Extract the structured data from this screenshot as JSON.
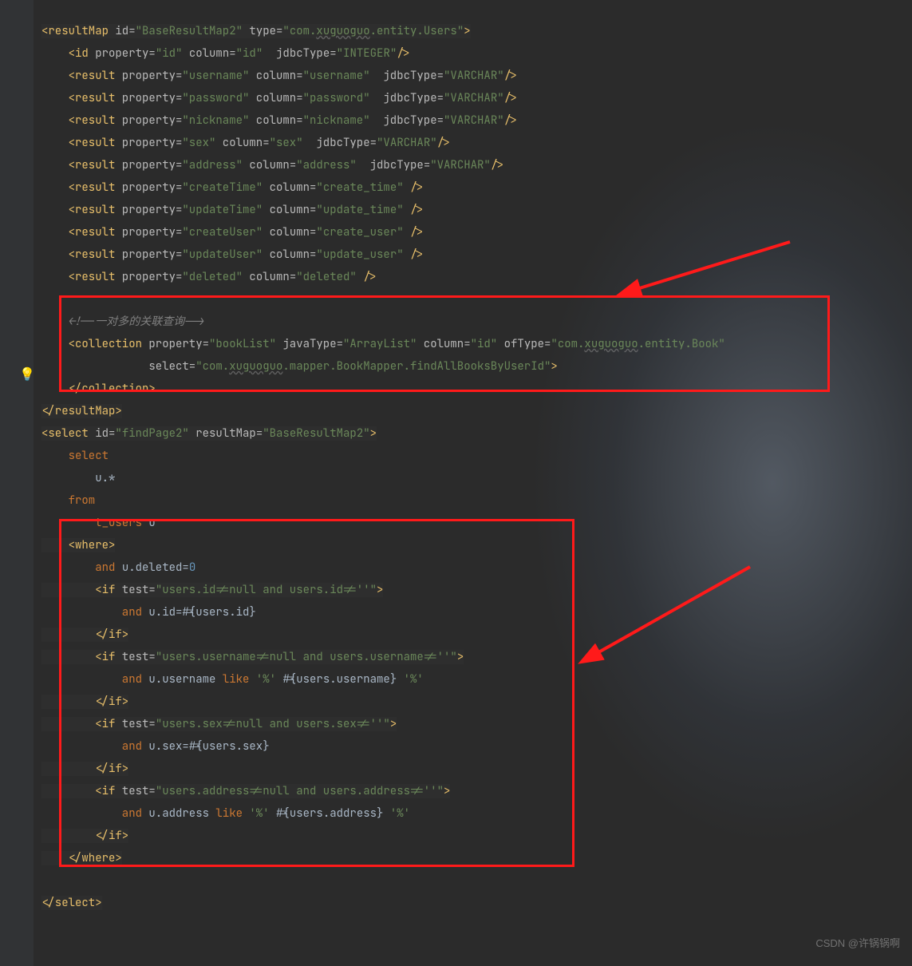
{
  "watermark": "CSDN @许锅锅啊",
  "code": {
    "lines": [
      {
        "i": 0,
        "hl": 1,
        "seg": [
          {
            "c": "t-tag",
            "t": "<resultMap"
          },
          {
            "c": "t-attr",
            "t": " id="
          },
          {
            "c": "t-str",
            "t": "\"BaseResultMap2\""
          },
          {
            "c": "t-attr",
            "t": " type="
          },
          {
            "c": "t-str",
            "t": "\"com."
          },
          {
            "c": "t-str t-wavy",
            "t": "xuguoguo"
          },
          {
            "c": "t-str",
            "t": ".entity.Users\""
          },
          {
            "c": "t-tag",
            "t": ">"
          }
        ]
      },
      {
        "i": 1,
        "seg": [
          {
            "c": "t-tag",
            "t": "<id"
          },
          {
            "c": "t-attr",
            "t": " property="
          },
          {
            "c": "t-str",
            "t": "\"id\""
          },
          {
            "c": "t-attr",
            "t": " column="
          },
          {
            "c": "t-str",
            "t": "\"id\""
          },
          {
            "c": "t-attr",
            "t": "  jdbcType="
          },
          {
            "c": "t-str",
            "t": "\"INTEGER\""
          },
          {
            "c": "t-tag",
            "t": "/>"
          }
        ]
      },
      {
        "i": 1,
        "seg": [
          {
            "c": "t-tag",
            "t": "<result"
          },
          {
            "c": "t-attr",
            "t": " property="
          },
          {
            "c": "t-str",
            "t": "\"username\""
          },
          {
            "c": "t-attr",
            "t": " column="
          },
          {
            "c": "t-str",
            "t": "\"username\""
          },
          {
            "c": "t-attr",
            "t": "  jdbcType="
          },
          {
            "c": "t-str",
            "t": "\"VARCHAR\""
          },
          {
            "c": "t-tag",
            "t": "/>"
          }
        ]
      },
      {
        "i": 1,
        "seg": [
          {
            "c": "t-tag",
            "t": "<result"
          },
          {
            "c": "t-attr",
            "t": " property="
          },
          {
            "c": "t-str",
            "t": "\"password\""
          },
          {
            "c": "t-attr",
            "t": " column="
          },
          {
            "c": "t-str",
            "t": "\"password\""
          },
          {
            "c": "t-attr",
            "t": "  jdbcType="
          },
          {
            "c": "t-str",
            "t": "\"VARCHAR\""
          },
          {
            "c": "t-tag",
            "t": "/>"
          }
        ]
      },
      {
        "i": 1,
        "seg": [
          {
            "c": "t-tag",
            "t": "<result"
          },
          {
            "c": "t-attr",
            "t": " property="
          },
          {
            "c": "t-str",
            "t": "\"nickname\""
          },
          {
            "c": "t-attr",
            "t": " column="
          },
          {
            "c": "t-str",
            "t": "\"nickname\""
          },
          {
            "c": "t-attr",
            "t": "  jdbcType="
          },
          {
            "c": "t-str",
            "t": "\"VARCHAR\""
          },
          {
            "c": "t-tag",
            "t": "/>"
          }
        ]
      },
      {
        "i": 1,
        "seg": [
          {
            "c": "t-tag",
            "t": "<result"
          },
          {
            "c": "t-attr",
            "t": " property="
          },
          {
            "c": "t-str",
            "t": "\"sex\""
          },
          {
            "c": "t-attr",
            "t": " column="
          },
          {
            "c": "t-str",
            "t": "\"sex\""
          },
          {
            "c": "t-attr",
            "t": "  jdbcType="
          },
          {
            "c": "t-str",
            "t": "\"VARCHAR\""
          },
          {
            "c": "t-tag",
            "t": "/>"
          }
        ]
      },
      {
        "i": 1,
        "seg": [
          {
            "c": "t-tag",
            "t": "<result"
          },
          {
            "c": "t-attr",
            "t": " property="
          },
          {
            "c": "t-str",
            "t": "\"address\""
          },
          {
            "c": "t-attr",
            "t": " column="
          },
          {
            "c": "t-str",
            "t": "\"address\""
          },
          {
            "c": "t-attr",
            "t": "  jdbcType="
          },
          {
            "c": "t-str",
            "t": "\"VARCHAR\""
          },
          {
            "c": "t-tag",
            "t": "/>"
          }
        ]
      },
      {
        "i": 1,
        "seg": [
          {
            "c": "t-tag",
            "t": "<result"
          },
          {
            "c": "t-attr",
            "t": " property="
          },
          {
            "c": "t-str",
            "t": "\"createTime\""
          },
          {
            "c": "t-attr",
            "t": " column="
          },
          {
            "c": "t-str",
            "t": "\"create_time\""
          },
          {
            "c": "t-tag",
            "t": " />"
          }
        ]
      },
      {
        "i": 1,
        "seg": [
          {
            "c": "t-tag",
            "t": "<result"
          },
          {
            "c": "t-attr",
            "t": " property="
          },
          {
            "c": "t-str",
            "t": "\"updateTime\""
          },
          {
            "c": "t-attr",
            "t": " column="
          },
          {
            "c": "t-str",
            "t": "\"update_time\""
          },
          {
            "c": "t-tag",
            "t": " />"
          }
        ]
      },
      {
        "i": 1,
        "seg": [
          {
            "c": "t-tag",
            "t": "<result"
          },
          {
            "c": "t-attr",
            "t": " property="
          },
          {
            "c": "t-str",
            "t": "\"createUser\""
          },
          {
            "c": "t-attr",
            "t": " column="
          },
          {
            "c": "t-str",
            "t": "\"create_user\""
          },
          {
            "c": "t-tag",
            "t": " />"
          }
        ]
      },
      {
        "i": 1,
        "seg": [
          {
            "c": "t-tag",
            "t": "<result"
          },
          {
            "c": "t-attr",
            "t": " property="
          },
          {
            "c": "t-str",
            "t": "\"updateUser\""
          },
          {
            "c": "t-attr",
            "t": " column="
          },
          {
            "c": "t-str",
            "t": "\"update_user\""
          },
          {
            "c": "t-tag",
            "t": " />"
          }
        ]
      },
      {
        "i": 1,
        "seg": [
          {
            "c": "t-tag",
            "t": "<result"
          },
          {
            "c": "t-attr",
            "t": " property="
          },
          {
            "c": "t-str",
            "t": "\"deleted\""
          },
          {
            "c": "t-attr",
            "t": " column="
          },
          {
            "c": "t-str",
            "t": "\"deleted\""
          },
          {
            "c": "t-tag",
            "t": " />"
          }
        ]
      },
      {
        "i": 0,
        "seg": []
      },
      {
        "i": 1,
        "seg": [
          {
            "c": "t-comment",
            "t": "<!--一对多的关联查询-->"
          }
        ]
      },
      {
        "i": 1,
        "seg": [
          {
            "c": "t-tag",
            "t": "<collection"
          },
          {
            "c": "t-attr",
            "t": " property="
          },
          {
            "c": "t-str",
            "t": "\"bookList\""
          },
          {
            "c": "t-attr",
            "t": " javaType="
          },
          {
            "c": "t-str",
            "t": "\"ArrayList\""
          },
          {
            "c": "t-attr",
            "t": " column="
          },
          {
            "c": "t-str",
            "t": "\"id\""
          },
          {
            "c": "t-attr",
            "t": " ofType="
          },
          {
            "c": "t-str",
            "t": "\"com."
          },
          {
            "c": "t-str t-wavy",
            "t": "xuguoguo"
          },
          {
            "c": "t-str",
            "t": ".entity.Book\""
          }
        ]
      },
      {
        "i": 4,
        "seg": [
          {
            "c": "t-attr",
            "t": "select="
          },
          {
            "c": "t-str",
            "t": "\"com."
          },
          {
            "c": "t-str t-wavy",
            "t": "xuguoguo"
          },
          {
            "c": "t-str",
            "t": ".mapper.BookMapper.findAllBooksByUserId\""
          },
          {
            "c": "t-tag",
            "t": ">"
          }
        ]
      },
      {
        "i": 1,
        "seg": [
          {
            "c": "t-tag",
            "t": "</collection>"
          }
        ]
      },
      {
        "i": 0,
        "hl": 1,
        "seg": [
          {
            "c": "t-tag",
            "t": "</resultMap>"
          }
        ]
      },
      {
        "i": 0,
        "hl": 1,
        "seg": [
          {
            "c": "t-tag",
            "t": "<select"
          },
          {
            "c": "t-attr",
            "t": " id="
          },
          {
            "c": "t-str",
            "t": "\"findPage2\""
          },
          {
            "c": "t-attr",
            "t": " resultMap="
          },
          {
            "c": "t-str",
            "t": "\"BaseResultMap2\""
          },
          {
            "c": "t-tag",
            "t": ">"
          }
        ]
      },
      {
        "i": 1,
        "seg": [
          {
            "c": "t-kw",
            "t": "select"
          }
        ]
      },
      {
        "i": 2,
        "seg": [
          {
            "c": "",
            "t": "u.*"
          }
        ]
      },
      {
        "i": 1,
        "seg": [
          {
            "c": "t-kw",
            "t": "from"
          }
        ]
      },
      {
        "i": 2,
        "seg": [
          {
            "c": "t-kw",
            "t": "t_users"
          },
          {
            "c": "",
            "t": " u"
          }
        ]
      },
      {
        "i": 1,
        "hl": 1,
        "seg": [
          {
            "c": "t-tag",
            "t": "<where>"
          }
        ]
      },
      {
        "i": 2,
        "seg": [
          {
            "c": "t-kw",
            "t": "and "
          },
          {
            "c": "",
            "t": "u.deleted="
          },
          {
            "c": "t-num",
            "t": "0"
          }
        ]
      },
      {
        "i": 2,
        "hl": 1,
        "seg": [
          {
            "c": "t-tag",
            "t": "<if"
          },
          {
            "c": "t-attr",
            "t": " test="
          },
          {
            "c": "t-str",
            "t": "\"users.id!=null and users.id!=''\""
          },
          {
            "c": "t-tag",
            "t": ">"
          }
        ]
      },
      {
        "i": 3,
        "seg": [
          {
            "c": "t-kw",
            "t": "and "
          },
          {
            "c": "",
            "t": "u.id=#{users.id}"
          }
        ]
      },
      {
        "i": 2,
        "hl": 1,
        "seg": [
          {
            "c": "t-tag",
            "t": "</if>"
          }
        ]
      },
      {
        "i": 2,
        "hl": 1,
        "seg": [
          {
            "c": "t-tag",
            "t": "<if"
          },
          {
            "c": "t-attr",
            "t": " test="
          },
          {
            "c": "t-str",
            "t": "\"users.username!=null and users.username!=''\""
          },
          {
            "c": "t-tag",
            "t": ">"
          }
        ]
      },
      {
        "i": 3,
        "seg": [
          {
            "c": "t-kw",
            "t": "and "
          },
          {
            "c": "",
            "t": "u.username "
          },
          {
            "c": "t-kw",
            "t": "like "
          },
          {
            "c": "t-str",
            "t": "'%' "
          },
          {
            "c": "",
            "t": "#{users.username} "
          },
          {
            "c": "t-str",
            "t": "'%'"
          }
        ]
      },
      {
        "i": 2,
        "hl": 1,
        "seg": [
          {
            "c": "t-tag",
            "t": "</if>"
          }
        ]
      },
      {
        "i": 2,
        "hl": 1,
        "seg": [
          {
            "c": "t-tag",
            "t": "<if"
          },
          {
            "c": "t-attr",
            "t": " test="
          },
          {
            "c": "t-str",
            "t": "\"users.sex!=null and users.sex!=''\""
          },
          {
            "c": "t-tag",
            "t": ">"
          }
        ]
      },
      {
        "i": 3,
        "seg": [
          {
            "c": "t-kw",
            "t": "and "
          },
          {
            "c": "",
            "t": "u.sex=#{users.sex}"
          }
        ]
      },
      {
        "i": 2,
        "hl": 1,
        "seg": [
          {
            "c": "t-tag",
            "t": "</if>"
          }
        ]
      },
      {
        "i": 2,
        "hl": 1,
        "seg": [
          {
            "c": "t-tag",
            "t": "<if"
          },
          {
            "c": "t-attr",
            "t": " test="
          },
          {
            "c": "t-str",
            "t": "\"users.address!=null and users.address!=''\""
          },
          {
            "c": "t-tag",
            "t": ">"
          }
        ]
      },
      {
        "i": 3,
        "seg": [
          {
            "c": "t-kw",
            "t": "and "
          },
          {
            "c": "",
            "t": "u.address "
          },
          {
            "c": "t-kw",
            "t": "like "
          },
          {
            "c": "t-str",
            "t": "'%' "
          },
          {
            "c": "",
            "t": "#{users.address} "
          },
          {
            "c": "t-str",
            "t": "'%'"
          }
        ]
      },
      {
        "i": 2,
        "hl": 1,
        "seg": [
          {
            "c": "t-tag",
            "t": "</if>"
          }
        ]
      },
      {
        "i": 1,
        "hl": 1,
        "seg": [
          {
            "c": "t-tag",
            "t": "</where>"
          }
        ]
      },
      {
        "i": 0,
        "seg": []
      },
      {
        "i": 0,
        "hl": 1,
        "seg": [
          {
            "c": "t-tag",
            "t": "</select>"
          }
        ]
      }
    ]
  }
}
